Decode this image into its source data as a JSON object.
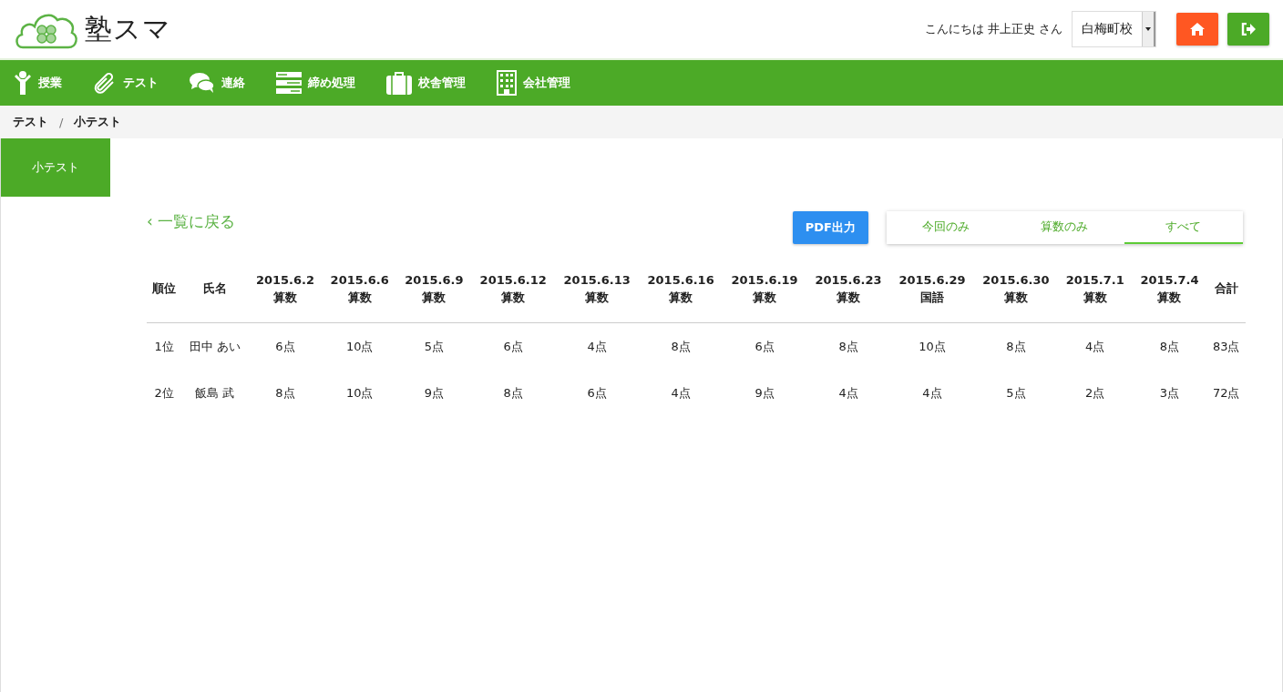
{
  "header": {
    "logo_text": "塾スマ",
    "greeting": "こんにちは 井上正史 さん",
    "school_select": {
      "value": "白梅町校"
    }
  },
  "nav": [
    {
      "kind": "person",
      "label": "授業"
    },
    {
      "kind": "clip",
      "label": "テスト"
    },
    {
      "kind": "chat",
      "label": "連絡"
    },
    {
      "kind": "drawers",
      "label": "締め処理"
    },
    {
      "kind": "case",
      "label": "校舎管理"
    },
    {
      "kind": "building",
      "label": "会社管理"
    }
  ],
  "breadcrumb": [
    "テスト",
    "/",
    "小テスト"
  ],
  "sidebar": {
    "items": [
      {
        "label": "小テスト",
        "selected": true
      }
    ]
  },
  "back_link": "‹ 一覧に戻る",
  "pdf_button": "PDF出力",
  "filter_tabs": [
    {
      "label": "今回のみ",
      "selected": false
    },
    {
      "label": "算数のみ",
      "selected": false
    },
    {
      "label": "すべて",
      "selected": true
    }
  ],
  "table": {
    "columns": [
      {
        "kind": "plain",
        "label": "順位"
      },
      {
        "kind": "plain",
        "label": "氏名"
      },
      {
        "kind": "test",
        "date": "2015.6.2",
        "subject": "算数"
      },
      {
        "kind": "test",
        "date": "2015.6.6",
        "subject": "算数"
      },
      {
        "kind": "test",
        "date": "2015.6.9",
        "subject": "算数"
      },
      {
        "kind": "test",
        "date": "2015.6.12",
        "subject": "算数"
      },
      {
        "kind": "test",
        "date": "2015.6.13",
        "subject": "算数"
      },
      {
        "kind": "test",
        "date": "2015.6.16",
        "subject": "算数"
      },
      {
        "kind": "test",
        "date": "2015.6.19",
        "subject": "算数"
      },
      {
        "kind": "test",
        "date": "2015.6.23",
        "subject": "算数"
      },
      {
        "kind": "test",
        "date": "2015.6.29",
        "subject": "国語"
      },
      {
        "kind": "test",
        "date": "2015.6.30",
        "subject": "算数"
      },
      {
        "kind": "test",
        "date": "2015.7.1",
        "subject": "算数"
      },
      {
        "kind": "test",
        "date": "2015.7.4",
        "subject": "算数"
      },
      {
        "kind": "plain",
        "label": "合計"
      }
    ],
    "rows": [
      [
        "1位",
        "田中 あい",
        "6点",
        "10点",
        "5点",
        "6点",
        "4点",
        "8点",
        "6点",
        "8点",
        "10点",
        "8点",
        "4点",
        "8点",
        "83点"
      ],
      [
        "2位",
        "飯島 武",
        "8点",
        "10点",
        "9点",
        "8点",
        "6点",
        "4点",
        "9点",
        "4点",
        "4点",
        "5点",
        "2点",
        "3点",
        "72点"
      ]
    ]
  }
}
